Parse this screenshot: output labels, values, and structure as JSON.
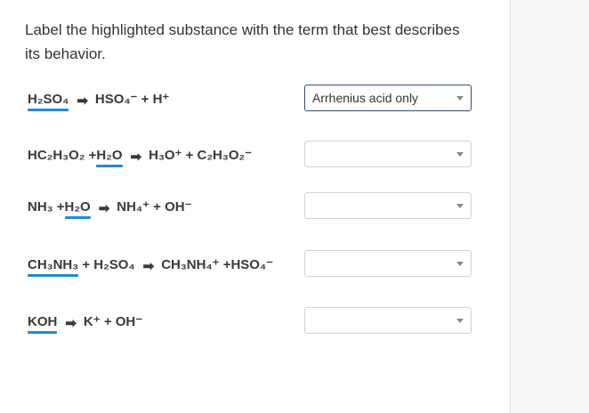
{
  "prompt": "Label the highlighted substance with the term that best describes its behavior.",
  "icons": {
    "arrow": "right-arrow-icon",
    "caret": "chevron-down-icon"
  },
  "colors": {
    "highlight": "#1f8ad6",
    "selected_border": "#2d4b7a"
  },
  "rows": [
    {
      "answer": "Arrhenius acid only",
      "parts": {
        "a": "H₂SO₄",
        "arrow": "➡",
        "b": "HSO₄⁻ + H⁺"
      }
    },
    {
      "answer": "",
      "parts": {
        "a": "HC₂H₃O₂ + ",
        "b": "H₂O",
        "arrow": "➡",
        "c": "H₃O⁺ + C₂H₃O₂⁻"
      }
    },
    {
      "answer": "",
      "parts": {
        "a": "NH₃ + ",
        "b": "H₂O",
        "arrow": "➡",
        "c": "NH₄⁺ + OH⁻"
      }
    },
    {
      "answer": "",
      "parts": {
        "a": "CH₃NH₃",
        "b": " + H₂SO₄",
        "arrow": "➡",
        "c": "CH₃NH₄⁺ +HSO₄⁻"
      }
    },
    {
      "answer": "",
      "parts": {
        "a": "KOH",
        "arrow": "➡",
        "b": "K⁺ + OH⁻"
      }
    }
  ]
}
